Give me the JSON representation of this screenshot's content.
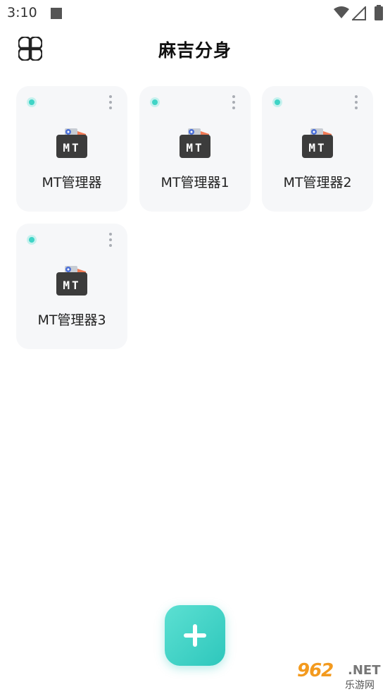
{
  "status_bar": {
    "time": "3:10"
  },
  "header": {
    "title": "麻吉分身",
    "menu_icon": "four-petal-grid-icon"
  },
  "apps": [
    {
      "name": "MT管理器",
      "icon_text": "MT",
      "running": true
    },
    {
      "name": "MT管理器1",
      "icon_text": "MT",
      "running": true
    },
    {
      "name": "MT管理器2",
      "icon_text": "MT",
      "running": true
    },
    {
      "name": "MT管理器3",
      "icon_text": "MT",
      "running": true
    }
  ],
  "fab": {
    "icon": "plus-icon"
  },
  "watermark": {
    "number": "962",
    "suffix": ".NET",
    "site_name": "乐游网"
  },
  "colors": {
    "accent": "#3fd4c6",
    "card_background": "#f6f7f9",
    "title_text": "#111111"
  }
}
